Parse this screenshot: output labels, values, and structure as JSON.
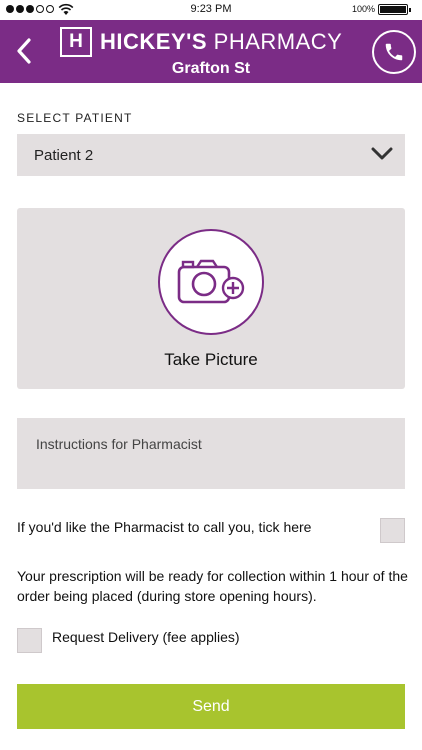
{
  "status_bar": {
    "time": "9:23 PM",
    "battery_percent": "100%",
    "signal_bars_filled": 3,
    "signal_bars_total": 5,
    "battery_level": 1.0
  },
  "header": {
    "logo_letter": "H",
    "brand_bold": "HICKEY'S",
    "brand_light": " PHARMACY",
    "branch": "Grafton St",
    "back_icon": "chevron-left-icon",
    "call_icon": "phone-icon"
  },
  "patient": {
    "section_label": "SELECT PATIENT",
    "selected": "Patient 2"
  },
  "camera": {
    "label": "Take Picture",
    "icon": "camera-plus-icon"
  },
  "instructions": {
    "placeholder": "Instructions for Pharmacist"
  },
  "call_back": {
    "label": "If you'd like the Pharmacist to call you, tick here",
    "checked": false
  },
  "info": {
    "text": "Your prescription will be ready for collection within 1 hour of the order being placed (during store opening hours)."
  },
  "delivery": {
    "label": "Request Delivery (fee applies)",
    "checked": false
  },
  "send": {
    "label": "Send"
  },
  "colors": {
    "brand_purple": "#7b2c86",
    "send_green": "#a8c42e",
    "field_grey": "#e3dfe0"
  }
}
